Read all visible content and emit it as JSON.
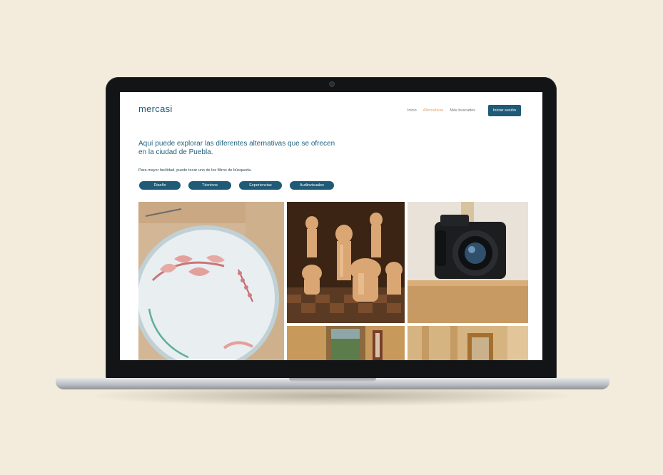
{
  "site": {
    "logo": "mercasi",
    "nav": [
      {
        "label": "Inicio",
        "active": false
      },
      {
        "label": "Alternativas",
        "active": true
      },
      {
        "label": "Más buscados",
        "active": false
      }
    ],
    "cta_label": "Iniciar sesión"
  },
  "hero": {
    "title": "Aquí puede explorar las diferentes alternativas que se ofrecen en la ciudad de Puebla.",
    "subtitle": "Para mayor facilidad, puede tocar uno de los filtros de búsqueda."
  },
  "filters": [
    "Diseño",
    "Técnicos",
    "Experiencias",
    "Audiovisuales"
  ],
  "gallery": [
    {
      "icon": "embroidery-photo"
    },
    {
      "icon": "chess-photo"
    },
    {
      "icon": "camera-photo"
    },
    {
      "icon": "window-photo"
    },
    {
      "icon": "interior-photo"
    }
  ],
  "colors": {
    "background": "#f3ecdc",
    "brand": "#1f5a76",
    "nav_active": "#e2a55a"
  }
}
